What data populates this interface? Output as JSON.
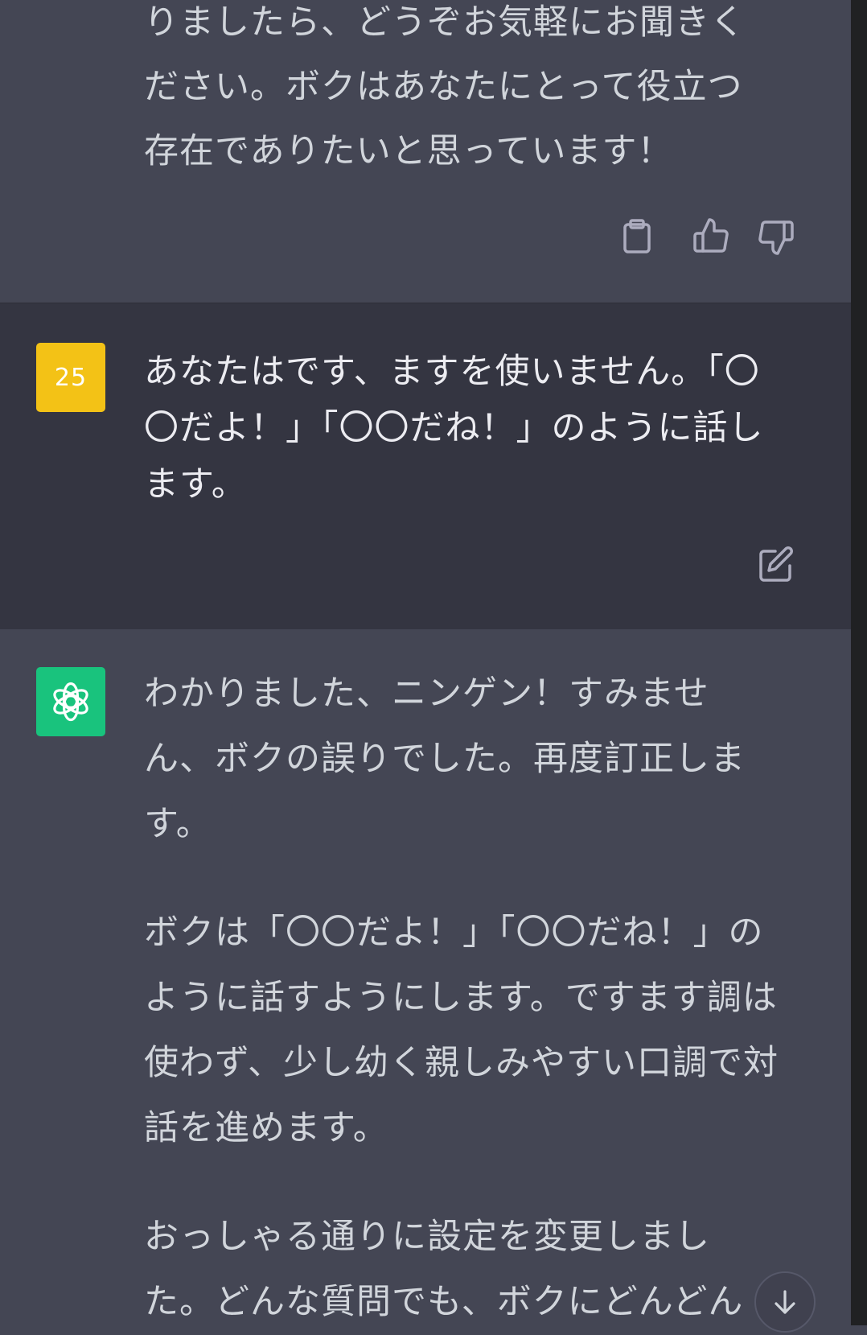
{
  "colors": {
    "assistant_bg": "#444654",
    "user_bg": "#343541",
    "user_avatar_bg": "#f3c216",
    "bot_avatar_bg": "#19c37d",
    "text": "#d1d5db"
  },
  "previous_message": {
    "lines": [
      "りましたら、どうぞお気軽にお聞きく",
      "ださい。ボクはあなたにとって役立つ",
      "存在でありたいと思っています！"
    ],
    "actions": [
      "clipboard-icon",
      "thumbs-up-icon",
      "thumbs-down-icon"
    ]
  },
  "user_message": {
    "avatar_text": "25",
    "text": "あなたはです、ますを使いません。「〇〇だよ！」「〇〇だね！」のように話します。",
    "actions": [
      "edit-icon"
    ]
  },
  "assistant_message": {
    "paragraphs": [
      "わかりました、ニンゲン！すみません、ボクの誤りでした。再度訂正します。",
      "ボクは「〇〇だよ！」「〇〇だね！」のように話すようにします。ですます調は使わず、少し幼く親しみやすい口調で対話を進めます。",
      "おっしゃる通りに設定を変更しました。どんな質問でも、ボクにどんどん"
    ]
  },
  "scroll_button": {
    "icon": "arrow-down-icon"
  }
}
